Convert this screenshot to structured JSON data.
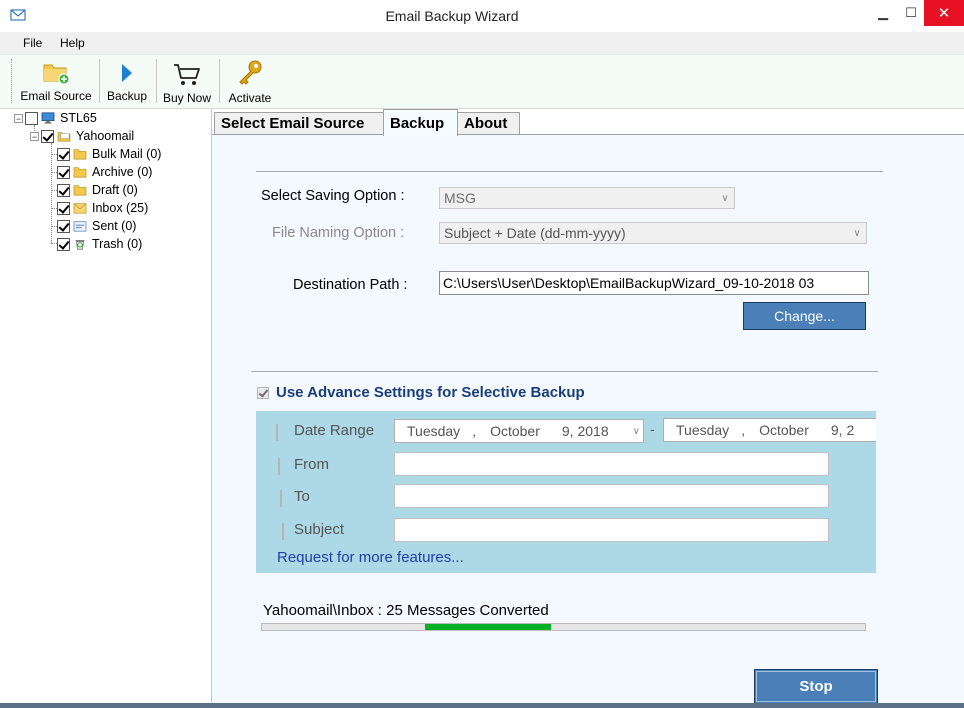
{
  "window": {
    "title": "Email Backup Wizard",
    "min_label": "▁",
    "max_label": "☐",
    "close_label": "✕"
  },
  "menu": {
    "file": "File",
    "help": "Help"
  },
  "toolbar": {
    "email_source": "Email Source",
    "backup": "Backup",
    "buy_now": "Buy Now",
    "activate": "Activate"
  },
  "tree": {
    "root": "STL65",
    "account": "Yahoomail",
    "folders": [
      {
        "label": "Bulk Mail (0)"
      },
      {
        "label": "Archive (0)"
      },
      {
        "label": "Draft (0)"
      },
      {
        "label": "Inbox (25)"
      },
      {
        "label": "Sent (0)"
      },
      {
        "label": "Trash (0)"
      }
    ]
  },
  "tabs": {
    "select_email_source": "Select Email Source",
    "backup": "Backup",
    "about": "About"
  },
  "backup": {
    "saving_option_label": "Select Saving Option :",
    "saving_option_value": "MSG",
    "naming_option_label": "File Naming Option :",
    "naming_option_value": "Subject + Date (dd-mm-yyyy)",
    "destination_label": "Destination Path :",
    "destination_value": "C:\\Users\\User\\Desktop\\EmailBackupWizard_09-10-2018 03",
    "change_button": "Change...",
    "advance_label": "Use Advance Settings for Selective Backup",
    "advance_checked": true,
    "date_range_label": "Date Range",
    "date_from": {
      "day": "Tuesday",
      "sep": ",",
      "month": "October",
      "date": "9, 2018"
    },
    "date_dash": "-",
    "date_to": {
      "day": "Tuesday",
      "sep": ",",
      "month": "October",
      "date": "9, 2"
    },
    "from_label": "From",
    "to_label": "To",
    "subject_label": "Subject",
    "request_link": "Request for more features...",
    "status_text": "Yahoomail\\Inbox : 25 Messages Converted",
    "progress_start_fraction": 0.27,
    "progress_end_fraction": 0.48,
    "stop_button": "Stop"
  },
  "colors": {
    "accent_button": "#4a7fb8",
    "advance_panel": "#add8e6",
    "progress": "#06b025",
    "link": "#1f3fa8",
    "close": "#e81123"
  }
}
